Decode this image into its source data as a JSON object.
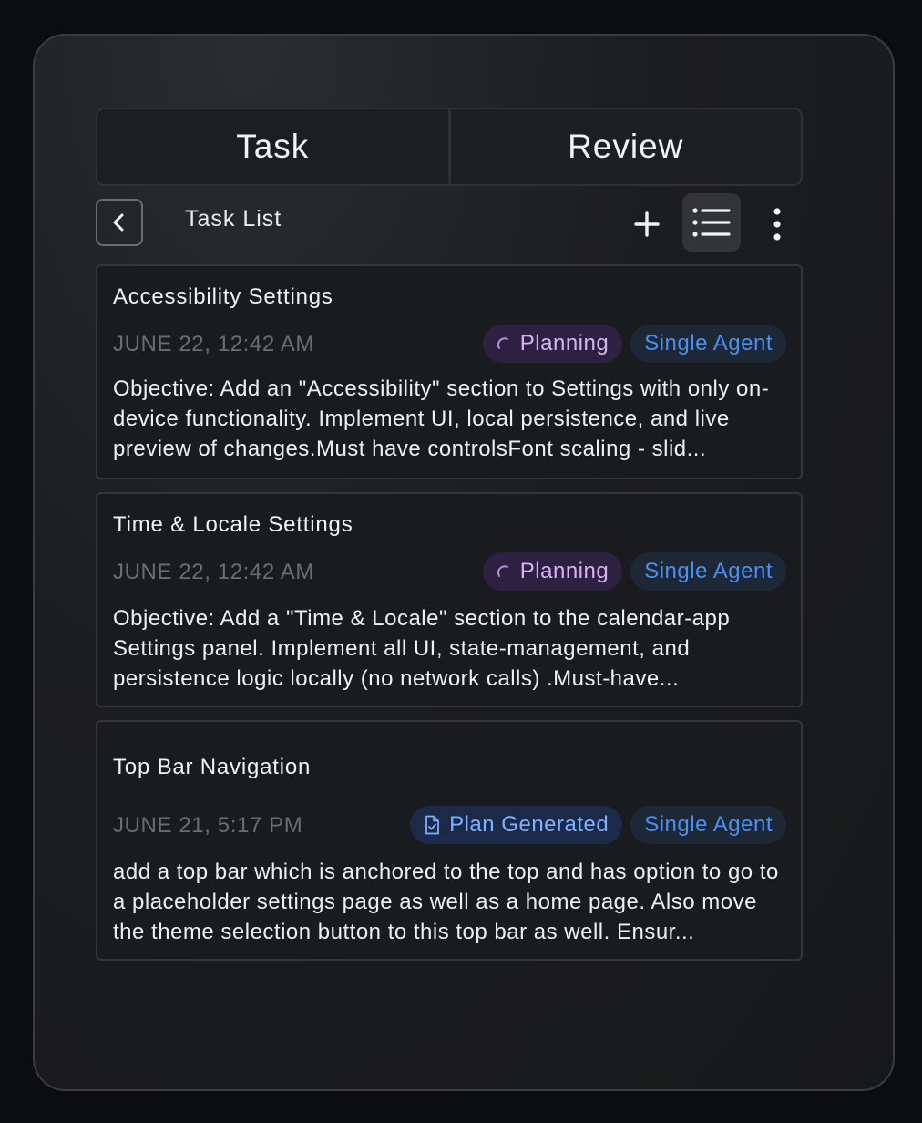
{
  "tabs": [
    {
      "label": "Task"
    },
    {
      "label": "Review"
    }
  ],
  "toolbar": {
    "title": "Task List",
    "back_icon": "chevron-left-icon",
    "add_icon": "plus-icon",
    "list_icon": "list-view-icon",
    "more_icon": "more-vertical-icon"
  },
  "tasks": [
    {
      "title": "Accessibility Settings",
      "date": "JUNE 22, 12:42 AM",
      "status": "Planning",
      "status_icon": "spinner-icon",
      "agent": "Single Agent",
      "description": "Objective: Add an \"Accessibility\" section to Settings with only on-device functionality. Implement UI, local persistence, and live preview of changes.Must have controlsFont scaling - slid..."
    },
    {
      "title": "Time & Locale Settings",
      "date": "JUNE 22, 12:42 AM",
      "status": "Planning",
      "status_icon": "spinner-icon",
      "agent": "Single Agent",
      "description": "Objective: Add a \"Time & Locale\" section to the calendar-app Settings panel. Implement all UI, state-management, and persistence logic locally (no network calls) .Must-have..."
    },
    {
      "title": "Top Bar Navigation",
      "date": "JUNE 21, 5:17 PM",
      "status": "Plan Generated",
      "status_icon": "document-check-icon",
      "agent": "Single Agent",
      "description": "add a top bar which is anchored to the top and has option to go to a placeholder settings page as well as a home page. Also move the theme selection button to this top bar as well. Ensur..."
    }
  ],
  "colors": {
    "background": "#0c0d10",
    "panel": "#1c1d20",
    "planning_badge": "#2d2040",
    "planning_text": "#d6b4f4",
    "generated_badge": "#1c2a4a",
    "generated_text": "#7fb0ff",
    "agent_badge": "#1d2736",
    "agent_text": "#4c8ff0"
  }
}
